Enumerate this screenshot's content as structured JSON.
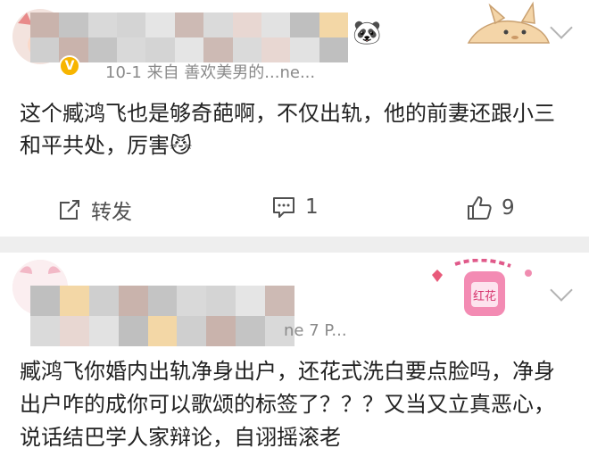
{
  "comments": [
    {
      "meta_text": "10-1 来自 善欢美男的...ne...",
      "emoji_inline": "🐼",
      "text": "这个臧鸿飞也是够奇葩啊，不仅出轨，他的前妻还跟小三和平共处，厉害",
      "text_emoji": "😼",
      "actions": {
        "repost_label": "转发",
        "comment_count": "1",
        "like_count": "9"
      }
    },
    {
      "meta_text": "ne 7 P...",
      "text": "臧鸿飞你婚内出轨净身出户，还花式洗白要点脸吗，净身出户咋的成你可以歌颂的标签了？？？又当又立真恶心，说话结巴学人家辩论，自诩摇滚老",
      "badge_text": "红花"
    }
  ],
  "colors": {
    "separator": "#eeeeee",
    "text": "#222222",
    "meta": "#8a8a8a",
    "icon": "#505050",
    "verified_badge": "#f7b500"
  }
}
